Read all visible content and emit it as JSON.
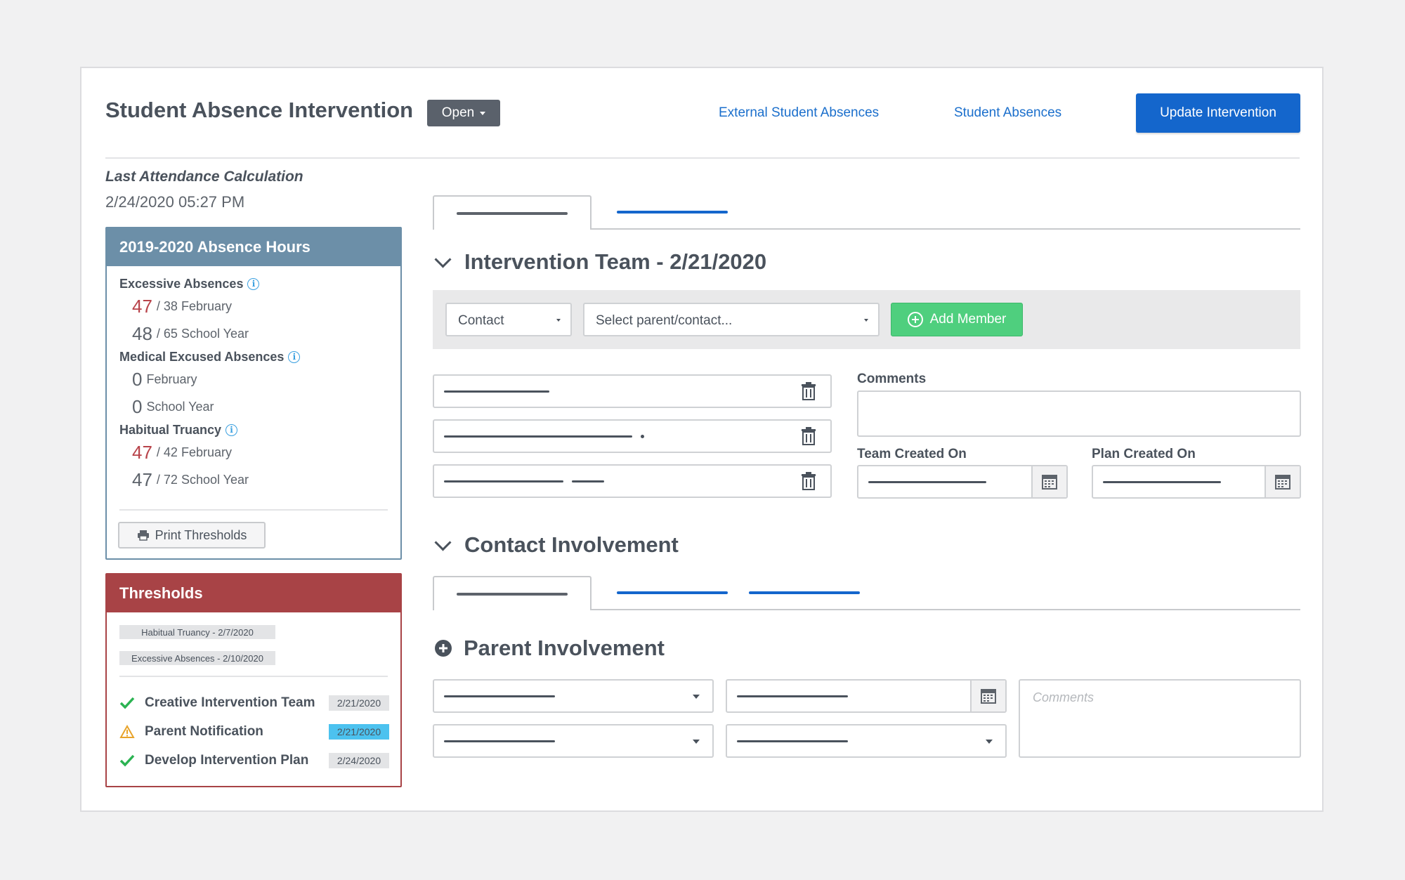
{
  "header": {
    "title": "Student Absence Intervention",
    "status_label": "Open",
    "link_external": "External Student Absences",
    "link_absences": "Student Absences",
    "update_button": "Update Intervention"
  },
  "attendance": {
    "label": "Last Attendance Calculation",
    "value": "2/24/2020 05:27 PM"
  },
  "absence_panel": {
    "title": "2019-2020 Absence Hours",
    "color": "#6c8fa8",
    "groups": [
      {
        "label": "Excessive Absences",
        "rows": [
          {
            "value": "47",
            "rest": "/ 38 February",
            "alert": true
          },
          {
            "value": "48",
            "rest": "/ 65 School Year",
            "alert": false
          }
        ]
      },
      {
        "label": "Medical Excused Absences",
        "rows": [
          {
            "value": "0",
            "rest": "February",
            "alert": false
          },
          {
            "value": "0",
            "rest": "School Year",
            "alert": false
          }
        ]
      },
      {
        "label": "Habitual Truancy",
        "rows": [
          {
            "value": "47",
            "rest": "/ 42 February",
            "alert": true
          },
          {
            "value": "47",
            "rest": "/ 72 School Year",
            "alert": false
          }
        ]
      }
    ],
    "print_button": "Print Thresholds"
  },
  "thresholds_panel": {
    "title": "Thresholds",
    "color": "#a84346",
    "tags": [
      "Habitual Truancy - 2/7/2020",
      "Excessive Absences - 2/10/2020"
    ],
    "items": [
      {
        "label": "Creative Intervention Team",
        "date": "2/21/2020",
        "status": "check-icon"
      },
      {
        "label": "Parent Notification",
        "date": "2/21/2020",
        "status": "warning-icon"
      },
      {
        "label": "Develop Intervention Plan",
        "date": "2/24/2020",
        "status": "check-icon"
      }
    ]
  },
  "team_section": {
    "title": "Intervention Team - 2/21/2020",
    "contact_select": "Contact",
    "parent_select": "Select parent/contact...",
    "add_button": "Add Member",
    "comments_label": "Comments",
    "team_created_label": "Team Created On",
    "plan_created_label": "Plan Created On"
  },
  "contact_section": {
    "title": "Contact Involvement"
  },
  "parent_section": {
    "title": "Parent Involvement",
    "comments_placeholder": "Comments"
  }
}
